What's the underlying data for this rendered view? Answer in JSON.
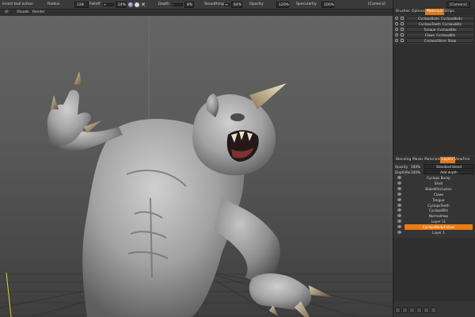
{
  "toolbar": {
    "tool_label": "Insert tool action",
    "radius_label": "Radius",
    "radius_value": "128",
    "falloff_label": "Falloff",
    "falloff_value": "24%",
    "depth_label": "Depth",
    "depth_value": "8%",
    "smoothing_label": "Smoothing",
    "smoothing_value": "64%",
    "opacity_label": "Opacity",
    "opacity_value": "120%",
    "specularity_label": "Specularity",
    "specularity_value": "100%",
    "camera_label": "[Camera]",
    "falloff_fraction": 0.24,
    "depth_fraction": 0.08,
    "smoothing_fraction": 0.64
  },
  "menu2": {
    "ui_label": "UI",
    "visuals_label": "Visuals",
    "render_label": "Render"
  },
  "panel": {
    "top_tabs": [
      "Brushes",
      "Options",
      "Materials",
      "Strips"
    ],
    "top_active_tab": "Materials",
    "materials": [
      "CyclopsBody_CyclopsBody",
      "CyclopsTeeth_CyclopsBits",
      "Tongue_CyclopsBits",
      "Claws_CyclopsBits",
      "CyclopsShine_Shop"
    ],
    "layer_tabs": [
      "Blending",
      "Masks",
      "Materials",
      "Layers",
      "ViewTree"
    ],
    "layer_active_tab": "Layers",
    "opacity_label": "Opacity",
    "opacity_value": "100%",
    "blend_mode": "Standard blend",
    "depth_label": "Depth/Re",
    "depth_value": "100%",
    "add_depth": "Add depth",
    "layers": [
      "Cyclops Bump",
      "Shell",
      "BakedOcclusion",
      "Claws",
      "Tongue",
      "CyclopsTeeth",
      "CyclopsBits",
      "Normalmap",
      "Layer 11",
      "CyclopsBodyColour",
      "Layer 1"
    ],
    "selected_layer": "CyclopsBodyColour"
  },
  "colors": {
    "accent": "#e07a1e",
    "panel_bg": "#353535",
    "toolbar_bg": "#3a3a3a",
    "viewport_top": "#646464",
    "viewport_bottom": "#3e3e3e"
  },
  "icons": {
    "sphere": "sphere-icon",
    "checker": "checker-icon",
    "close": "close-icon",
    "eye": "eye-icon",
    "lock": "lock-icon"
  }
}
